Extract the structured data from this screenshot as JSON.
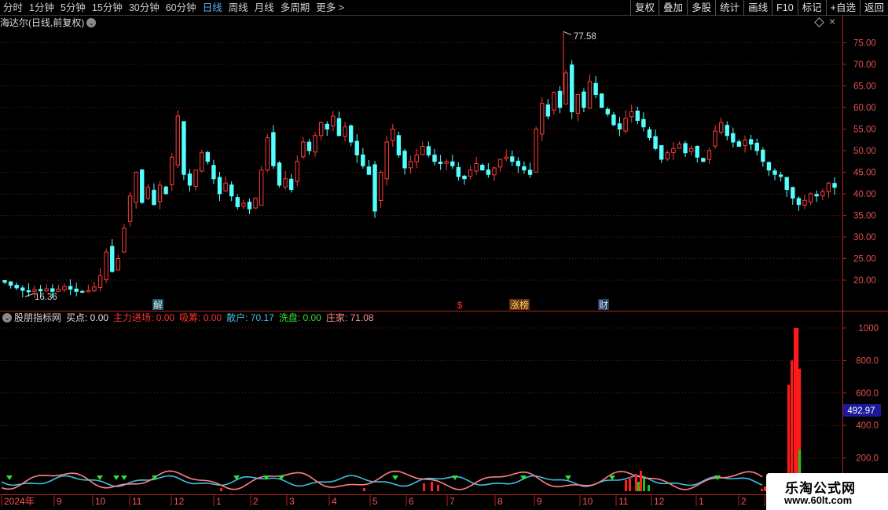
{
  "toolbar": {
    "periods": [
      "分时",
      "1分钟",
      "5分钟",
      "15分钟",
      "30分钟",
      "60分钟",
      "日线",
      "周线",
      "月线",
      "多周期",
      "更多 >"
    ],
    "active_period": "日线",
    "actions": [
      "复权",
      "叠加",
      "多股",
      "统计",
      "画线",
      "F10",
      "标记",
      "+自选",
      "返回"
    ]
  },
  "price_panel": {
    "title": "海达尔(日线,前复权)",
    "high_label": "77.58",
    "low_label": "16.36",
    "y_ticks": [
      "75.00",
      "70.00",
      "65.00",
      "60.00",
      "55.00",
      "50.00",
      "45.00",
      "40.00",
      "35.00",
      "30.00",
      "25.00",
      "20.00"
    ],
    "markers": [
      "解",
      "$",
      "涨榜",
      "财"
    ]
  },
  "indicator_panel": {
    "name": "股朋指标网",
    "legend": [
      {
        "label": "买点:",
        "value": "0.00",
        "color": "#e0e0e0"
      },
      {
        "label": "主力进场:",
        "value": "0.00",
        "color": "#ff3030"
      },
      {
        "label": "吸筹:",
        "value": "0.00",
        "color": "#ff3030"
      },
      {
        "label": "散户:",
        "value": "70.17",
        "color": "#40c0e0"
      },
      {
        "label": "洗盘:",
        "value": "0.00",
        "color": "#30e030"
      },
      {
        "label": "庄家:",
        "value": "71.08",
        "color": "#ff9090"
      }
    ],
    "y_ticks": [
      "1000",
      "800.0",
      "600.0",
      "400.0",
      "200.0"
    ],
    "cursor_value": "492.97"
  },
  "time_axis": [
    "2024年",
    "9",
    "10",
    "11",
    "12",
    "1",
    "2",
    "3",
    "4",
    "5",
    "6",
    "7",
    "8",
    "9",
    "10",
    "11",
    "12",
    "1",
    "2",
    "3"
  ],
  "watermark": {
    "title": "乐淘公式网",
    "url": "www.60lt.com"
  },
  "chart_data": {
    "type": "candlestick",
    "title": "海达尔(日线,前复权)",
    "ylim": [
      15,
      80
    ],
    "high": 77.58,
    "low": 16.36,
    "closes": [
      19.5,
      18.8,
      18.2,
      17.6,
      17.3,
      17.8,
      17.5,
      18.0,
      17.4,
      17.9,
      18.5,
      17.9,
      17.4,
      17.2,
      17.6,
      18.4,
      21.0,
      26.5,
      22.0,
      25.0,
      32.0,
      39.5,
      45.0,
      38.0,
      41.5,
      37.5,
      42.0,
      40.0,
      48.5,
      58.0,
      44.5,
      42.0,
      45.5,
      49.5,
      47.5,
      43.5,
      40.0,
      42.5,
      39.5,
      37.0,
      37.8,
      36.5,
      39.0,
      45.5,
      53.0,
      46.5,
      42.0,
      43.5,
      41.0,
      47.5,
      52.0,
      50.0,
      53.5,
      56.5,
      55.0,
      58.0,
      53.5,
      55.5,
      52.0,
      49.0,
      46.5,
      44.5,
      36.0,
      45.0,
      52.0,
      55.0,
      49.0,
      46.0,
      47.5,
      49.0,
      51.0,
      49.0,
      47.5,
      47.0,
      47.5,
      46.5,
      44.0,
      43.5,
      45.5,
      47.0,
      45.5,
      44.5,
      46.0,
      48.0,
      48.5,
      47.5,
      46.5,
      45.5,
      44.5,
      55.0,
      61.0,
      58.0,
      63.5,
      60.0,
      68.0,
      59.0,
      63.0,
      60.0,
      66.0,
      63.0,
      60.0,
      58.5,
      56.0,
      55.0,
      57.5,
      59.0,
      57.0,
      55.5,
      53.0,
      50.5,
      48.0,
      49.5,
      50.5,
      51.5,
      49.5,
      50.5,
      48.5,
      47.5,
      50.0,
      54.5,
      56.5,
      53.5,
      52.0,
      51.0,
      52.5,
      51.5,
      50.0,
      47.5,
      45.5,
      44.5,
      44.0,
      41.0,
      39.0,
      37.5,
      38.5,
      40.0,
      39.5,
      40.5,
      42.5,
      41.5
    ]
  }
}
